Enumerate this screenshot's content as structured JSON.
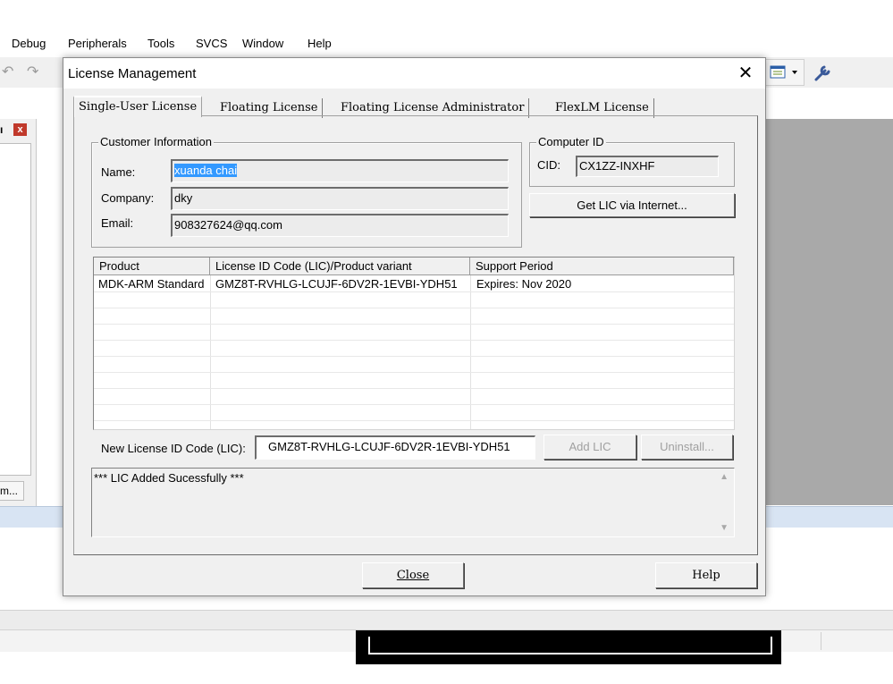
{
  "menubar": {
    "items": [
      "Debug",
      "Peripherals",
      "Tools",
      "SVCS",
      "Window",
      "Help"
    ]
  },
  "left_panel": {
    "tab_label": "m...",
    "close_glyph": "x"
  },
  "dialog": {
    "title": "License Management",
    "close_glyph": "✕",
    "tabs": [
      "Single-User License",
      "Floating License",
      "Floating License Administrator",
      "FlexLM License"
    ],
    "active_tab": "Single-User License",
    "customer_info": {
      "legend": "Customer Information",
      "name_label": "Name:",
      "name_value": "xuanda chai",
      "company_label": "Company:",
      "company_value": "dky",
      "email_label": "Email:",
      "email_value": "908327624@qq.com"
    },
    "computer_id": {
      "legend": "Computer ID",
      "cid_label": "CID:",
      "cid_value": "CX1ZZ-INXHF",
      "get_lic_button": "Get LIC via Internet..."
    },
    "license_table": {
      "columns": [
        "Product",
        "License ID Code (LIC)/Product variant",
        "Support Period"
      ],
      "rows": [
        [
          "MDK-ARM Standard",
          "GMZ8T-RVHLG-LCUJF-6DV2R-1EVBI-YDH51",
          "Expires: Nov 2020"
        ]
      ]
    },
    "new_lic": {
      "label": "New License ID Code (LIC):",
      "value": "GMZ8T-RVHLG-LCUJF-6DV2R-1EVBI-YDH51",
      "add_button": "Add LIC",
      "uninstall_button": "Uninstall..."
    },
    "status_message": "*** LIC Added Sucessfully ***",
    "close_button": "Close",
    "help_button": "Help"
  },
  "icons": {
    "undo": "undo-icon",
    "redo": "redo-icon",
    "window": "window-layout-icon",
    "settings": "wrench-icon"
  }
}
